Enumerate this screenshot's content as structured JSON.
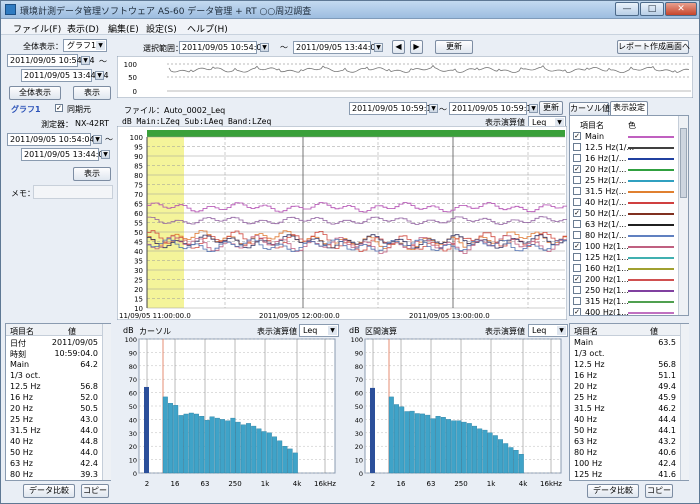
{
  "window": {
    "title": "環境計測データ管理ソフトウェア AS-60 データ管理 + RT ○○周辺調査"
  },
  "menu": [
    "ファイル(F)",
    "表示(D)",
    "編集(E)",
    "設定(S)",
    "ヘルプ(H)"
  ],
  "overview": {
    "show_all_label": "全体表示：",
    "graph_select": "グラフ1",
    "start": "2011/09/05 10:54:04",
    "end": "2011/09/05 13:44:04",
    "tilde": "〜",
    "show_all_button": "全体表示",
    "show_button": "表示"
  },
  "range": {
    "label": "選択範囲：",
    "start": "2011/09/05 10:54:04",
    "end": "2011/09/05 13:44:04",
    "tilde": "〜",
    "update": "更新",
    "report_button": "レポート作成画面へ"
  },
  "overview_chart": {
    "ticks": [
      "100",
      "50",
      "0"
    ]
  },
  "left": {
    "graph_title": "グラフ1",
    "sync_label": "同期元",
    "device_label": "測定器：",
    "device": "NX-42RT",
    "start": "2011/09/05 10:54:04",
    "end": "2011/09/05 13:44:04",
    "tilde": "〜",
    "show": "表示",
    "memo_label": "メモ："
  },
  "main_chart": {
    "file": "ファイル：Auto_0002_Leq",
    "range_start": "2011/09/05 10:59:12",
    "range_end": "2011/09/05 10:59:12",
    "tilde": "〜",
    "update": "更新",
    "header": "dB  Main:LZeq Sub:LAeq Band:LZeq",
    "value_label": "表示演算値",
    "value_select": "Leq",
    "yticks": [
      "100",
      "95",
      "90",
      "85",
      "80",
      "75",
      "70",
      "65",
      "60",
      "55",
      "50",
      "45",
      "40",
      "35",
      "30",
      "25",
      "20",
      "15",
      "10"
    ],
    "xlabels": [
      "11/09/05 11:00:00.0",
      "2011/09/05 12:00:00.0",
      "2011/09/05 13:00:00.0"
    ]
  },
  "legend": {
    "tabs": [
      "カーソル値",
      "表示設定"
    ],
    "col_item": "項目名",
    "col_color": "色",
    "items": [
      {
        "name": "Main",
        "checked": true,
        "color": "#c060c0"
      },
      {
        "name": "12.5 Hz(1/...",
        "checked": false,
        "color": "#404040"
      },
      {
        "name": "16 Hz(1/...",
        "checked": false,
        "color": "#2040a0"
      },
      {
        "name": "20 Hz(1/...",
        "checked": true,
        "color": "#30a040"
      },
      {
        "name": "25 Hz(1/...",
        "checked": false,
        "color": "#30a0c0"
      },
      {
        "name": "31.5 Hz(...",
        "checked": false,
        "color": "#e08030"
      },
      {
        "name": "40 Hz(1/...",
        "checked": false,
        "color": "#d04040"
      },
      {
        "name": "50 Hz(1/...",
        "checked": true,
        "color": "#803020"
      },
      {
        "name": "63 Hz(1/...",
        "checked": false,
        "color": "#202020"
      },
      {
        "name": "80 Hz(1/...",
        "checked": false,
        "color": "#6080c0"
      },
      {
        "name": "100 Hz(1...",
        "checked": true,
        "color": "#c06080"
      },
      {
        "name": "125 Hz(1...",
        "checked": false,
        "color": "#40b0b0"
      },
      {
        "name": "160 Hz(1...",
        "checked": false,
        "color": "#a0a030"
      },
      {
        "name": "200 Hz(1...",
        "checked": true,
        "color": "#d05050"
      },
      {
        "name": "250 Hz(1...",
        "checked": false,
        "color": "#8040a0"
      },
      {
        "name": "315 Hz(1...",
        "checked": false,
        "color": "#50a050"
      },
      {
        "name": "400 Hz(1...",
        "checked": true,
        "color": "#c070c0"
      }
    ]
  },
  "cursor_table": {
    "col_item": "項目名",
    "col_value": "値",
    "rows": [
      [
        "日付",
        "2011/09/05"
      ],
      [
        "時刻",
        "10:59:04.0"
      ],
      [
        "Main",
        "64.2"
      ],
      [
        "1/3 oct.",
        ""
      ],
      [
        "12.5 Hz",
        "56.8"
      ],
      [
        "16 Hz",
        "52.0"
      ],
      [
        "20 Hz",
        "50.5"
      ],
      [
        "25 Hz",
        "43.0"
      ],
      [
        "31.5 Hz",
        "44.0"
      ],
      [
        "40 Hz",
        "44.8"
      ],
      [
        "50 Hz",
        "44.0"
      ],
      [
        "63 Hz",
        "42.4"
      ],
      [
        "80 Hz",
        "39.3"
      ]
    ],
    "buttons": [
      "データ比較",
      "コピー"
    ]
  },
  "cursor_chart": {
    "unit": "dB",
    "title": "カーソル",
    "value_label": "表示演算値",
    "value_select": "Leq",
    "yticks": [
      "100",
      "90",
      "80",
      "70",
      "60",
      "50",
      "40",
      "30",
      "20",
      "10",
      "0"
    ],
    "xticks": [
      "2",
      "16",
      "63",
      "250",
      "1k",
      "4k",
      "16kHz"
    ]
  },
  "section_chart": {
    "unit": "dB",
    "title": "区間演算",
    "value_label": "表示演算値",
    "value_select": "Leq",
    "yticks": [
      "100",
      "90",
      "80",
      "70",
      "60",
      "50",
      "40",
      "30",
      "20",
      "10",
      "0"
    ],
    "xticks": [
      "2",
      "16",
      "63",
      "250",
      "1k",
      "4k",
      "16kHz"
    ]
  },
  "section_table": {
    "col_item": "項目名",
    "col_value": "値",
    "rows": [
      [
        "Main",
        "63.5"
      ],
      [
        "1/3 oct.",
        ""
      ],
      [
        "12.5 Hz",
        "56.8"
      ],
      [
        "16 Hz",
        "51.1"
      ],
      [
        "20 Hz",
        "49.4"
      ],
      [
        "25 Hz",
        "45.9"
      ],
      [
        "31.5 Hz",
        "46.2"
      ],
      [
        "40 Hz",
        "44.4"
      ],
      [
        "50 Hz",
        "44.1"
      ],
      [
        "63 Hz",
        "43.2"
      ],
      [
        "80 Hz",
        "40.6"
      ],
      [
        "100 Hz",
        "42.4"
      ],
      [
        "125 Hz",
        "41.6"
      ]
    ],
    "buttons": [
      "データ比較",
      "コピー"
    ]
  },
  "colors": {
    "bar": "#3fa3c8",
    "main_bar": "#2b4f9a",
    "cursor_band": "#f4f49a",
    "grid": "#909090"
  }
}
